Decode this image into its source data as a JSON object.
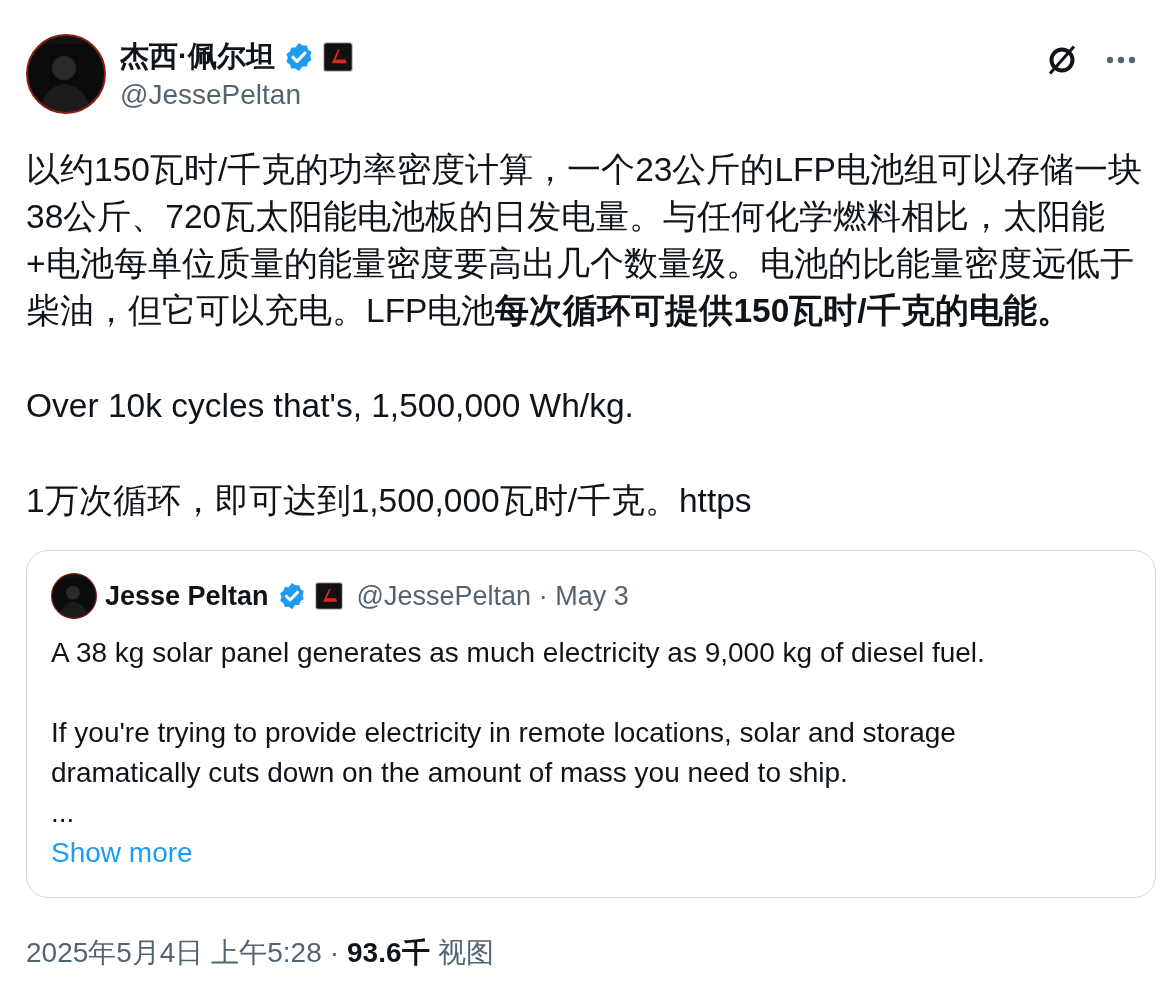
{
  "author": {
    "name": "杰西·佩尔坦",
    "handle": "@JessePeltan",
    "verified": true
  },
  "body": [
    {
      "lines": [
        "以约150瓦时/千克的功率密度计算，一个23公斤的LFP电池组可以存储一块",
        "38公斤、720瓦太阳能电池板的日发电量。与任何化学燃料相比，太阳能",
        "+电池每单位质量的能量密度要高出几个数量级。电池的比能量密度远低于",
        "柴油，但它可以充电。LFP电池**每次循环可提供150瓦时/千克的电能。**"
      ]
    },
    {
      "lines": [
        "Over 10k cycles that's, 1,500,000 Wh/kg."
      ]
    },
    {
      "lines": [
        "1万次循环，即可达到1,500,000瓦时/千克。https"
      ]
    }
  ],
  "quote": {
    "name": "Jesse Peltan",
    "verified": true,
    "handle": "@JessePeltan",
    "separator": "·",
    "date": "May 3",
    "paragraphs": [
      "A 38 kg solar panel generates as much electricity as 9,000 kg of diesel fuel.",
      "If you're trying to provide electricity in remote locations, solar and storage dramatically cuts down on the amount of mass you need to ship."
    ],
    "ellipsis": "...",
    "show_more": "Show more"
  },
  "meta": {
    "time": "2025年5月4日 上午5:28",
    "separator": "·",
    "views_count": "93.6千",
    "views_label": "视图"
  }
}
